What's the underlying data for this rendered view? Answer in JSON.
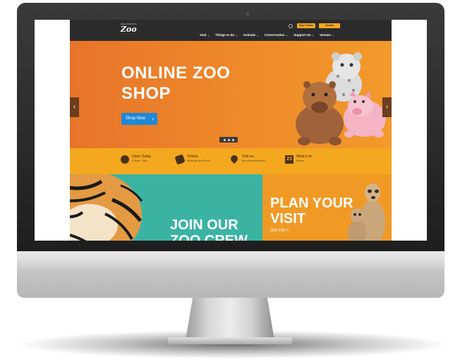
{
  "site": {
    "logo_top": "WELLINGTON",
    "logo_main": "Zoo"
  },
  "header": {
    "buy_tickets": "Buy Tickets",
    "donate": "Donate",
    "nav": [
      "Visit",
      "Things to do",
      "Animals",
      "Conservation",
      "Support Us",
      "Venues"
    ],
    "chevron": "⌄"
  },
  "hero": {
    "title_line1": "ONLINE ZOO",
    "title_line2": "SHOP",
    "button_label": "Shop Now",
    "button_arrow": "›",
    "arrow_prev": "‹",
    "arrow_next": "›"
  },
  "infobar": {
    "items": [
      {
        "title": "Open Today",
        "sub": "9:30am - 5pm",
        "icon": "clock-icon"
      },
      {
        "title": "Tickets",
        "sub": "Bookings and Prices",
        "icon": "ticket-icon"
      },
      {
        "title": "Visit us",
        "sub": "Bus and parking info",
        "icon": "map-pin-icon"
      },
      {
        "title": "What's on",
        "sub": "Events",
        "icon": "calendar-icon",
        "icon_text": "23"
      }
    ]
  },
  "promos": {
    "join_line1": "JOIN OUR",
    "join_line2": "ZOO CREW",
    "plan_line1": "PLAN YOUR",
    "plan_line2": "VISIT",
    "plan_link": "Get Info >"
  },
  "colors": {
    "header": "#2b2b2b",
    "hero": "#ef8a2a",
    "accent_blue": "#1f88d8",
    "infobar": "#f3a81f",
    "teal": "#3bb3a3"
  }
}
